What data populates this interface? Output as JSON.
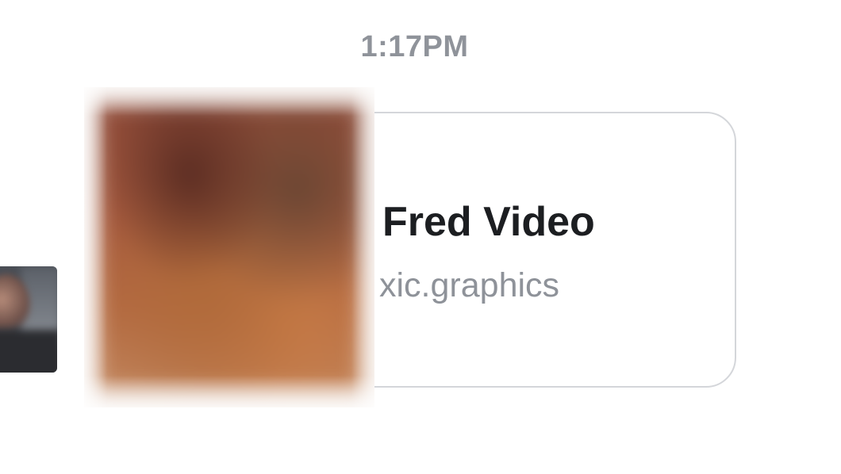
{
  "message": {
    "timestamp": "1:17PM"
  },
  "link_preview": {
    "title": "Fred Video",
    "domain": "xic.graphics"
  },
  "colors": {
    "timestamp": "#8f939a",
    "title": "#1c1e21",
    "domain": "#8e9299",
    "card_border": "#d4d6da"
  }
}
